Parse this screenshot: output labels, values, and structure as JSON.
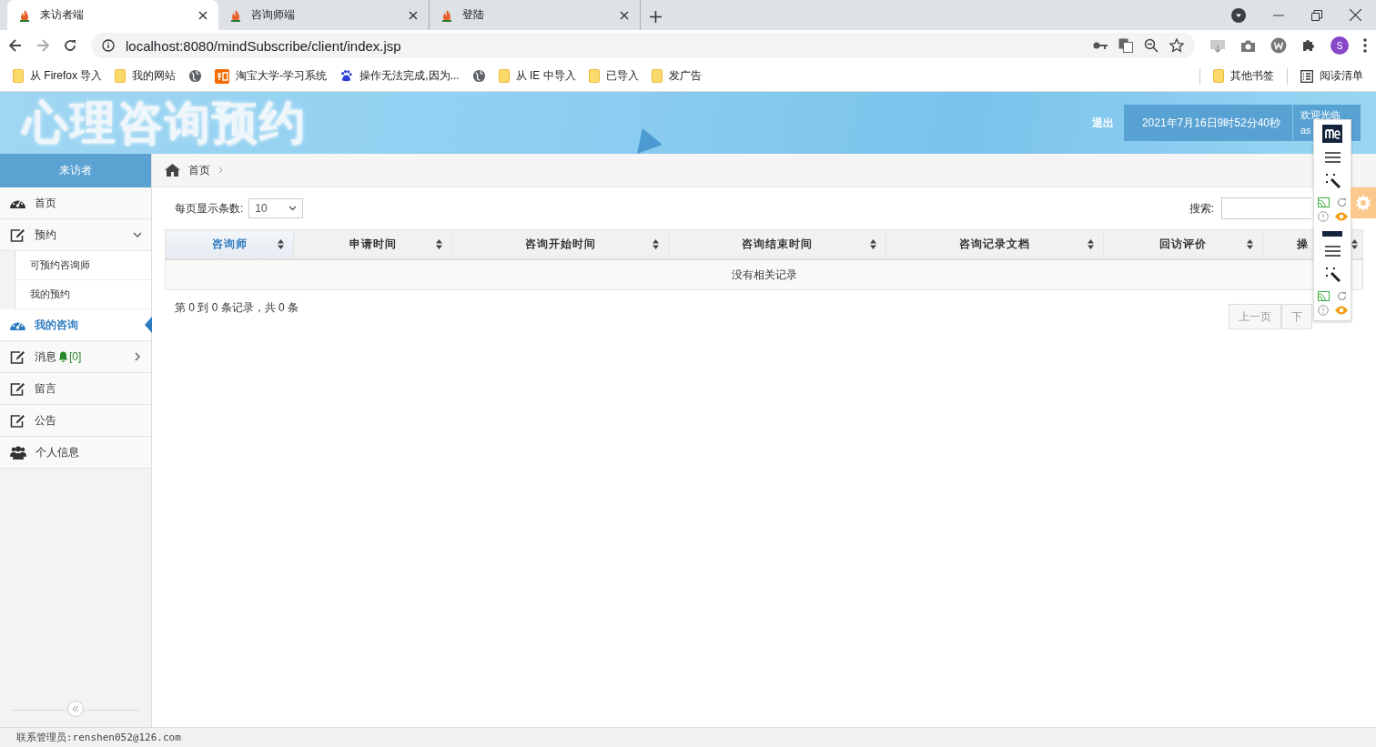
{
  "browser": {
    "tabs": [
      {
        "title": "来访者端",
        "selected": true
      },
      {
        "title": "咨询师端",
        "selected": false
      },
      {
        "title": "登陆",
        "selected": false
      }
    ],
    "address": {
      "url": "localhost:8080/mindSubscribe/client/index.jsp"
    },
    "profile_initial": "S",
    "bookmarks": [
      {
        "label": "从 Firefox 导入",
        "kind": "folder"
      },
      {
        "label": "我的网站",
        "kind": "folder"
      },
      {
        "kind": "globe"
      },
      {
        "label": "淘宝大学-学习系统",
        "kind": "taobao"
      },
      {
        "label": "操作无法完成,因为...",
        "kind": "paw"
      },
      {
        "kind": "globe"
      },
      {
        "label": "从 IE 中导入",
        "kind": "folder"
      },
      {
        "label": "已导入",
        "kind": "folder"
      },
      {
        "label": "发广告",
        "kind": "folder"
      }
    ],
    "other_bookmarks": "其他书签",
    "reading_list": "阅读清单"
  },
  "header": {
    "logo_text": "心理咨询预约",
    "logout": "退出",
    "datetime": "2021年7月16日9时52分40秒",
    "welcome": "欢迎光临",
    "user": "as"
  },
  "sidebar": {
    "title": "来访者",
    "items": [
      {
        "label": "首页",
        "selected": false
      },
      {
        "label": "预约",
        "selected": false,
        "expanded": true,
        "children": [
          {
            "label": "可预约咨询师",
            "selected": false
          },
          {
            "label": "我的预约",
            "selected": false
          }
        ]
      },
      {
        "label": "我的咨询",
        "selected": true
      },
      {
        "label": "消息",
        "selected": false,
        "expanded": false,
        "badge": "[0]"
      },
      {
        "label": "留言",
        "selected": false
      },
      {
        "label": "公告",
        "selected": false
      },
      {
        "label": "个人信息",
        "selected": false
      }
    ]
  },
  "breadcrumb": [
    {
      "label": "首页"
    }
  ],
  "table": {
    "page_size_label": "每页显示条数:",
    "page_size": "10",
    "search_label": "搜索:",
    "columns": [
      {
        "label": "咨询师",
        "sorted": true
      },
      {
        "label": "申请时间",
        "sorted": false
      },
      {
        "label": "咨询开始时间",
        "sorted": false
      },
      {
        "label": "咨询结束时间",
        "sorted": false
      },
      {
        "label": "咨询记录文档",
        "sorted": false
      },
      {
        "label": "回访评价",
        "sorted": false
      },
      {
        "label": "操",
        "sorted": false
      }
    ],
    "empty_text": "没有相关记录",
    "info": "第 0 到 0 条记录，共 0 条",
    "pager": [
      {
        "label": "上一页",
        "disabled": true
      },
      {
        "label": "下",
        "disabled": true
      }
    ]
  },
  "footer": {
    "contact": "联系管理员:renshen052@126.com"
  }
}
